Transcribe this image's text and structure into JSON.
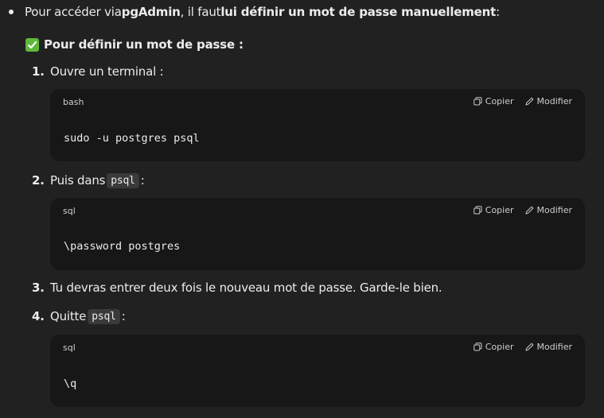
{
  "intro": {
    "prefix": "Pour accéder via ",
    "app_name": "pgAdmin",
    "middle": ", il faut ",
    "bold_phrase": "lui définir un mot de passe manuellement",
    "suffix": " :"
  },
  "heading": {
    "icon": "check-mark-icon",
    "text": "Pour définir un mot de passe :"
  },
  "steps": [
    {
      "number": "1.",
      "text": "Ouvre un terminal :"
    },
    {
      "number": "2.",
      "text_before": "Puis dans",
      "code": "psql",
      "text_after": ":"
    },
    {
      "number": "3.",
      "text": "Tu devras entrer deux fois le nouveau mot de passe. Garde-le bien."
    },
    {
      "number": "4.",
      "text_before": "Quitte",
      "code": "psql",
      "text_after": ":"
    }
  ],
  "code_blocks": [
    {
      "language": "bash",
      "code": "sudo -u postgres psql",
      "copy_label": "Copier",
      "edit_label": "Modifier"
    },
    {
      "language": "sql",
      "code": "\\password postgres",
      "copy_label": "Copier",
      "edit_label": "Modifier"
    },
    {
      "language": "sql",
      "code": "\\q",
      "copy_label": "Copier",
      "edit_label": "Modifier"
    }
  ],
  "colors": {
    "background": "#212121",
    "code_background": "#171717",
    "text": "#ececec",
    "check_green": "#5fb83a"
  }
}
